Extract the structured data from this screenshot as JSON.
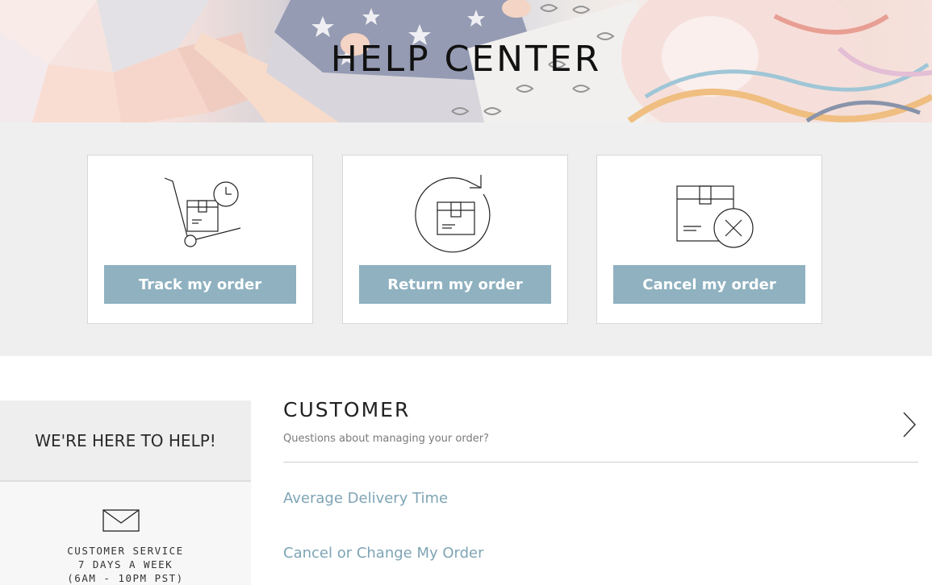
{
  "hero": {
    "title": "HELP CENTER"
  },
  "actions": [
    {
      "label": "Track my order",
      "icon": "hand-truck-clock-icon"
    },
    {
      "label": "Return my order",
      "icon": "box-return-arrow-icon"
    },
    {
      "label": "Cancel my order",
      "icon": "box-cancel-icon"
    }
  ],
  "help": {
    "heading": "WE'RE HERE TO HELP!",
    "contact_icon": "envelope-icon",
    "service_lines": [
      "CUSTOMER SERVICE",
      "7 DAYS A WEEK",
      "(6AM - 10PM PST)"
    ]
  },
  "category": {
    "title": "CUSTOMER",
    "subtitle": "Questions about managing your order?",
    "expand_icon": "chevron-right-icon",
    "links": [
      "Average Delivery Time",
      "Cancel or Change My Order"
    ]
  },
  "colors": {
    "button": "#8fb1c0",
    "link": "#7ea4b5",
    "band": "#efefef"
  }
}
